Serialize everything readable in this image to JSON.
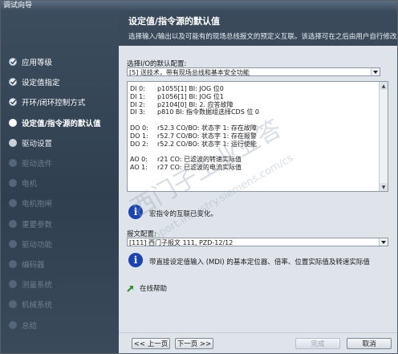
{
  "window": {
    "title": "调试向导"
  },
  "sidebar": {
    "items": [
      {
        "label": "应用等级",
        "state": "done"
      },
      {
        "label": "设定值指定",
        "state": "done"
      },
      {
        "label": "开环/闭环控制方式",
        "state": "done"
      },
      {
        "label": "设定值/指令源的默认值",
        "state": "current"
      },
      {
        "label": "驱动设置",
        "state": "pending"
      },
      {
        "label": "驱动选件",
        "state": "disabled"
      },
      {
        "label": "电机",
        "state": "disabled"
      },
      {
        "label": "电机抱闸",
        "state": "disabled"
      },
      {
        "label": "重要参数",
        "state": "disabled"
      },
      {
        "label": "驱动功能",
        "state": "disabled"
      },
      {
        "label": "编码器",
        "state": "disabled"
      },
      {
        "label": "测量系统",
        "state": "disabled"
      },
      {
        "label": "机械系统",
        "state": "disabled"
      },
      {
        "label": "总结",
        "state": "disabled"
      }
    ]
  },
  "header": {
    "title": "设定值/指令源的默认值",
    "subtitle": "选择输入/输出以及可能有的现场总线报文的预定义互联。该选择可在之后由用户自行修改。"
  },
  "io_config": {
    "label": "选择I/O的默认配置:",
    "value": "[5] 送技术，带有现场总线和基本安全功能"
  },
  "io_list": [
    {
      "k": "DI 0:",
      "v": "p1055[1] BI: JOG 位0"
    },
    {
      "k": "DI 1:",
      "v": "p1056[1] BI: JOG 位1"
    },
    {
      "k": "DI 2:",
      "v": "p2104[0] BI: 2. 应答故障"
    },
    {
      "k": "DI 3:",
      "v": "p810 BI: 指令数据组选择CDS 位 0"
    },
    {
      "k": "",
      "v": ""
    },
    {
      "k": "DO 0:",
      "v": "r52.3 CO/BO: 状态字 1: 存在故障"
    },
    {
      "k": "DO 1:",
      "v": "r52.7 CO/BO: 状态字 1: 存在报警"
    },
    {
      "k": "DO 2:",
      "v": "r52.2 CO/BO: 状态字 1: 运行使能"
    },
    {
      "k": "",
      "v": ""
    },
    {
      "k": "AO 0:",
      "v": "r21 CO: 已滤波的转速实际值"
    },
    {
      "k": "AO 1:",
      "v": "r27 CO: 已滤波的电流实际值"
    }
  ],
  "info1": {
    "text": "宏指令的互联已变化。"
  },
  "telegram": {
    "label": "报文配置:",
    "value": "[111] 西门子报文 111, PZD-12/12"
  },
  "info2": {
    "text": "带直接设定值输入 (MDI) 的基本定位器、倍率、位置实际值及转速实际值"
  },
  "help_link": {
    "label": "在线帮助"
  },
  "footer": {
    "prev": "<< 上一页",
    "next": "下一页 >>",
    "finish": "完成",
    "cancel": "取消"
  },
  "watermark": {
    "text1": "西门子工业业答",
    "text2": "support.industry.siemens.com/cs"
  },
  "colors": {
    "sidebar": "#3a4a5b",
    "info_icon": "#1b43b4",
    "link_arrow": "#2e8b2e"
  }
}
